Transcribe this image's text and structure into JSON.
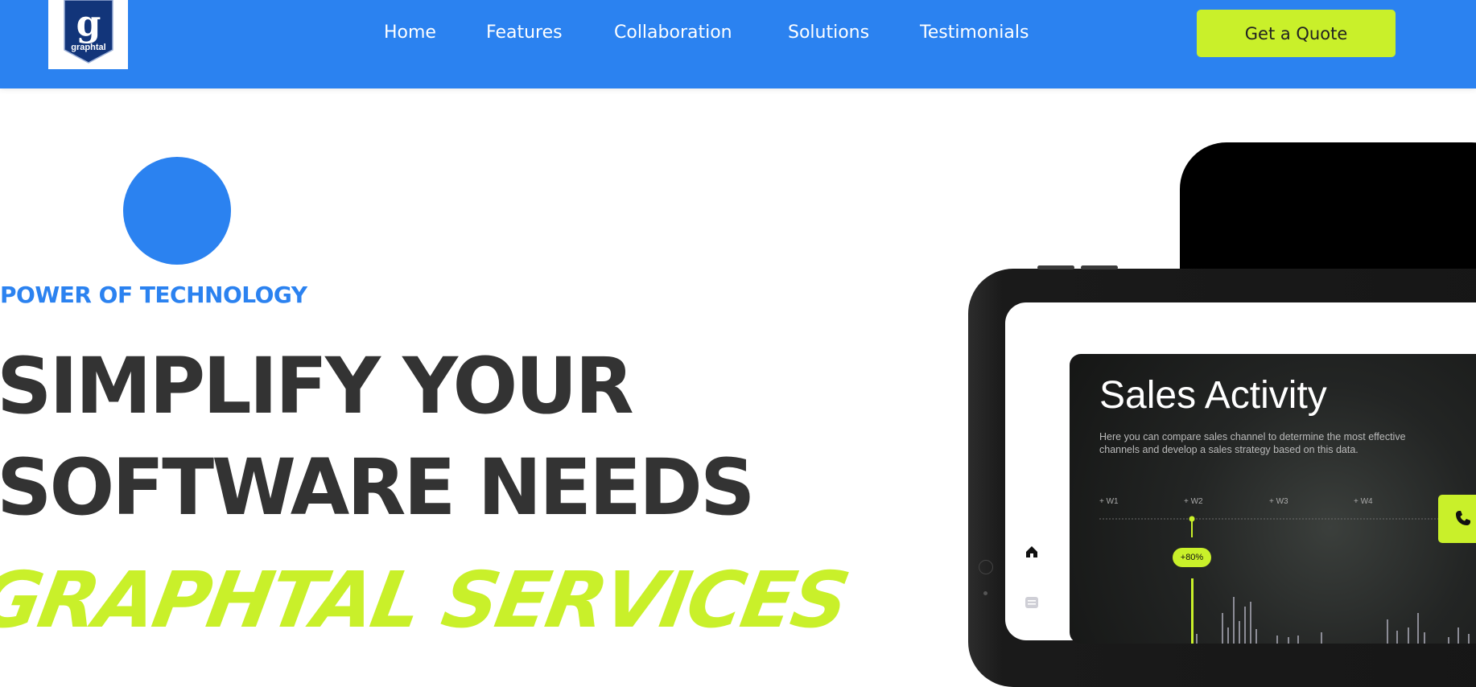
{
  "brand": {
    "logo_letter": "g",
    "logo_name": "graphtal"
  },
  "nav": {
    "items": [
      {
        "label": "Home"
      },
      {
        "label": "Features"
      },
      {
        "label": "Collaboration"
      },
      {
        "label": "Solutions"
      },
      {
        "label": "Testimonials"
      }
    ],
    "cta_label": "Get a Quote"
  },
  "hero": {
    "eyebrow": "POWER OF TECHNOLOGY",
    "headline_line1": "SIMPLIFY YOUR",
    "headline_line2": "SOFTWARE NEEDS",
    "highlight": "GRAPHTAL SERVICES"
  },
  "dashboard": {
    "title": "Sales Activity",
    "description": "Here you can compare sales channel to determine the most effective channels and develop a sales strategy based on this data.",
    "weeks": [
      "+ W1",
      "+ W2",
      "+ W3",
      "+ W4"
    ],
    "badge": "+80%"
  },
  "colors": {
    "primary_blue": "#2b82f0",
    "accent_lime": "#c9f02a",
    "heading_dark": "#333333"
  },
  "icons": {
    "floating_contact": "phone-icon",
    "sidebar_home": "home-icon",
    "sidebar_list": "list-icon"
  }
}
